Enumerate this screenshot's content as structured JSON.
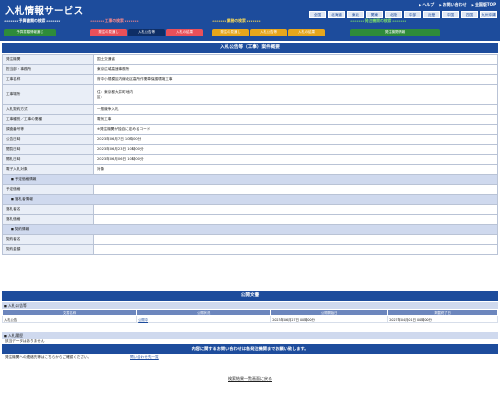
{
  "header": {
    "brand": "入札情報サービス",
    "top_links": [
      "ヘルプ",
      "お問い合わせ",
      "全国版TOP"
    ],
    "regions": [
      "全国",
      "北海道",
      "東北",
      "関東",
      "北陸",
      "中部",
      "近畿",
      "中国",
      "四国",
      "九州沖縄"
    ],
    "groups": [
      {
        "title": "予算書類の検索",
        "color": "#ffffff",
        "tabs": [
          {
            "label": "予算書類情報通じ",
            "color": "#2e8b3a",
            "active": false
          }
        ]
      },
      {
        "title": "工事の検索",
        "color": "#ff8a8a",
        "tabs": [
          {
            "label": "発注の見通し",
            "color": "#e9505a",
            "active": false
          },
          {
            "label": "入札公告等",
            "color": "#0e2e66",
            "active": true
          },
          {
            "label": "入札の結果",
            "color": "#e9505a",
            "active": false
          }
        ]
      },
      {
        "title": "業務の検索",
        "color": "#ffdd55",
        "tabs": [
          {
            "label": "発注の見通し",
            "color": "#e6a61c",
            "active": false
          },
          {
            "label": "入札公告等",
            "color": "#e6a61c",
            "active": false
          },
          {
            "label": "入札の結果",
            "color": "#e6a61c",
            "active": false
          }
        ]
      },
      {
        "title": "発注機関の検索",
        "color": "#7ddc6a",
        "tabs": [
          {
            "label": "発注機関情報",
            "color": "#2e8b3a",
            "active": false
          }
        ]
      }
    ]
  },
  "main": {
    "title": "入札公告等（工事）案件概要",
    "rows": [
      {
        "label": "発注機関",
        "value": "国土交通省"
      },
      {
        "label": "担当部・事務所",
        "value": "東京広域高速事務所"
      },
      {
        "label": "工事名称",
        "value": "府中小規模区内線北区高所作業車保護環境工事"
      },
      {
        "label": "工事場所",
        "address": [
          "住：東京都大井町地内",
          "区："
        ]
      },
      {
        "label": "入札契約方式",
        "value": "一般競争入札"
      },
      {
        "label": "工事種別／工事の業種",
        "value": "電気工事"
      },
      {
        "label": "調査番号等",
        "value": "※発注機関が独自に定めるコード"
      },
      {
        "label": "公告日時",
        "value": "2023年06月7日 10時00分"
      },
      {
        "label": "閲覧日時",
        "value": "2023年06月23日 10時00分"
      },
      {
        "label": "開札日時",
        "value": "2023年06月06日 10時00分"
      },
      {
        "label": "電子入札対象",
        "value": "対象"
      },
      {
        "section": "予定価格情報"
      },
      {
        "label": "予定価格",
        "value": ""
      },
      {
        "section": "落札者情報"
      },
      {
        "label": "落札者名",
        "value": ""
      },
      {
        "label": "落札価格",
        "value": ""
      },
      {
        "section": "契約情報"
      },
      {
        "label": "契約者名",
        "value": ""
      },
      {
        "label": "契約金額",
        "value": ""
      }
    ]
  },
  "documents": {
    "title": "公開文書",
    "heading": "入札公告等",
    "columns": [
      "文書名称",
      "公開状況",
      "公開開始日",
      "掲載終了日"
    ],
    "rows": [
      {
        "name": "入札公告",
        "status": "公開中",
        "start": "2023年06月27日 00時00分",
        "end": "2027年04月01日 00時00分"
      }
    ]
  },
  "history": {
    "heading": "入札履歴",
    "body": "該当データはありません"
  },
  "inquiry": {
    "title": "内容に関するお問い合わせは各発注機関までお願い致します。",
    "label": "発注機関への連絡先等はこちらからご確認ください。",
    "link": "問い合わせ先一覧"
  },
  "footer": {
    "back_link": "検索結果一覧画面に戻る"
  }
}
